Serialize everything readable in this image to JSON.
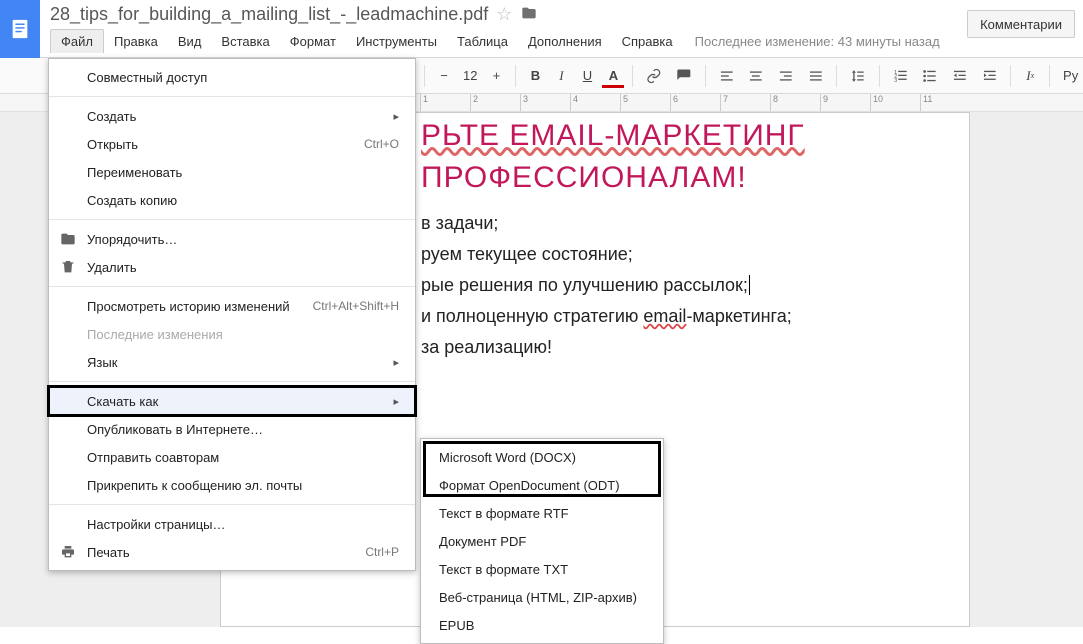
{
  "header": {
    "title": "28_tips_for_building_a_mailing_list_-_leadmachine.pdf",
    "comments_btn": "Комментарии",
    "last_edit": "Последнее изменение: 43 минуты назад"
  },
  "menubar": {
    "file": "Файл",
    "edit": "Правка",
    "view": "Вид",
    "insert": "Вставка",
    "format": "Формат",
    "tools": "Инструменты",
    "table": "Таблица",
    "addons": "Дополнения",
    "help": "Справка"
  },
  "toolbar": {
    "font_size": "12",
    "bold": "B",
    "italic": "I",
    "underline": "U",
    "textcolor": "A",
    "spellcheck": "Ру"
  },
  "ruler": [
    "1",
    "2",
    "3",
    "4",
    "5",
    "6",
    "7",
    "8",
    "9",
    "10",
    "11"
  ],
  "file_menu": {
    "share": "Совместный доступ",
    "new": "Создать",
    "open": "Открыть",
    "open_sc": "Ctrl+O",
    "rename": "Переименовать",
    "make_copy": "Создать копию",
    "organize": "Упорядочить…",
    "delete": "Удалить",
    "history": "Просмотреть историю изменений",
    "history_sc": "Ctrl+Alt+Shift+H",
    "recent": "Последние изменения",
    "language": "Язык",
    "download": "Скачать как",
    "publish": "Опубликовать в Интернете…",
    "email_collab": "Отправить соавторам",
    "email_attach": "Прикрепить к сообщению эл. почты",
    "page_setup": "Настройки страницы…",
    "print": "Печать",
    "print_sc": "Ctrl+P"
  },
  "download_submenu": {
    "docx": "Microsoft Word (DOCX)",
    "odt": "Формат OpenDocument (ODT)",
    "rtf": "Текст в формате RTF",
    "pdf": "Документ PDF",
    "txt": "Текст в формате TXT",
    "html": "Веб-страница (HTML, ZIP-архив)",
    "epub": "EPUB"
  },
  "doc": {
    "h1": "РЬТЕ EMAIL‑МАРКЕТИНГ",
    "h2": "ПРОФЕССИОНАЛАМ!",
    "l1": "в задачи;",
    "l2": "руем текущее состояние;",
    "l3": "рые решения по улучшению рассылок;",
    "l4a": "и полноценную стратегию ",
    "l4b": "email",
    "l4c": "-маркетинга;",
    "l5": "за реализацию!"
  }
}
